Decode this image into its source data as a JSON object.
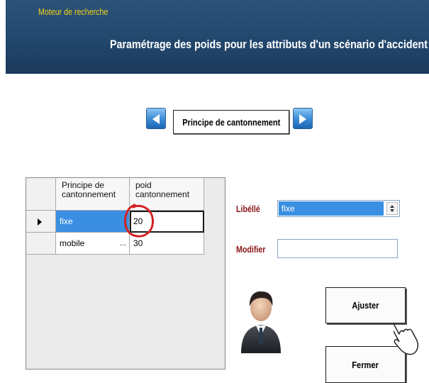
{
  "header": {
    "app_name": "Moteur de recherche",
    "title": "Paramétrage des poids pour les attributs d'un scénario d'accident"
  },
  "navigation": {
    "prev_icon": "arrow-left-icon",
    "next_icon": "arrow-right-icon",
    "current_category": "Principe de cantonnement"
  },
  "grid": {
    "columns": [
      "Principe de cantonnement",
      "poid cantonnement"
    ],
    "col1_line1": "Principe de",
    "col1_line2": "cantonnement",
    "col2_line1": "poid",
    "col2_line2": "cantonnement",
    "rows": [
      {
        "label": "fixe",
        "value": "20",
        "ellipsis": "..."
      },
      {
        "label": "mobile",
        "value": "30",
        "ellipsis": "..."
      }
    ],
    "current_row_marker": "row-pointer-icon"
  },
  "form": {
    "libelle_label": "Libéllé",
    "libelle_value": "fixe",
    "modifier_label": "Modifier",
    "modifier_value": ""
  },
  "buttons": {
    "adjust": "Ajuster",
    "close": "Fermer"
  },
  "colors": {
    "header_bg": "#244a70",
    "app_name": "#f2d21c",
    "label_color": "#8a1515",
    "selection": "#3a8fe2",
    "annotation_circle": "#d42020"
  }
}
